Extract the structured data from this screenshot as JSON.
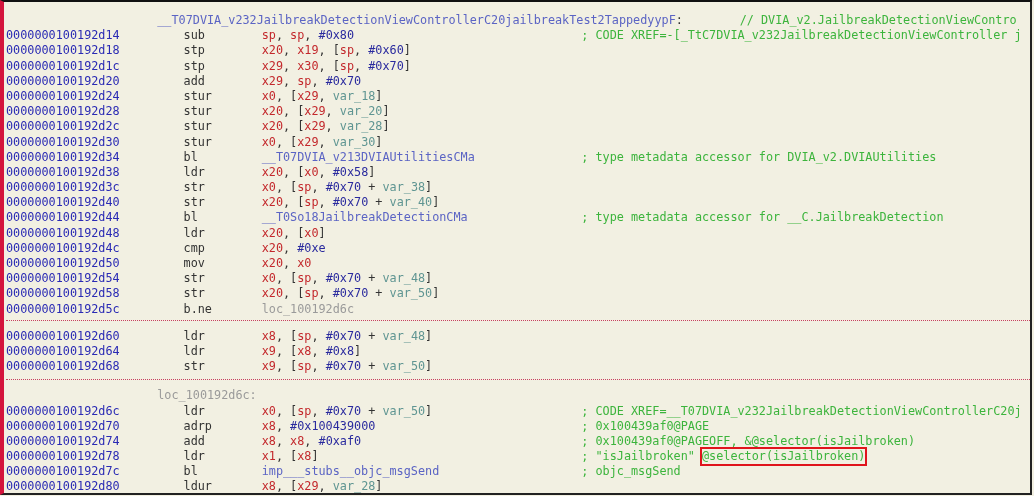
{
  "blocks": [
    {
      "label": [
        {
          "kind": "sym",
          "text": "__T07DVIA_v232JailbreakDetectionViewControllerC20jailbreakTest2TappedyypF"
        },
        {
          "kind": "pun",
          "text": ":"
        }
      ],
      "label_comment": "// DVIA_v2.JailbreakDetectionViewContro",
      "rows": [
        {
          "address": "0000000100192d14",
          "mnemonic": "sub",
          "operands": [
            {
              "kind": "reg",
              "text": "sp"
            },
            {
              "kind": "pun",
              "text": ", "
            },
            {
              "kind": "reg",
              "text": "sp"
            },
            {
              "kind": "pun",
              "text": ", "
            },
            {
              "kind": "imm",
              "text": "#0x80"
            }
          ],
          "comment": "; CODE XREF=-[_TtC7DVIA_v232JailbreakDetectionViewController j"
        },
        {
          "address": "0000000100192d18",
          "mnemonic": "stp",
          "operands": [
            {
              "kind": "reg",
              "text": "x20"
            },
            {
              "kind": "pun",
              "text": ", "
            },
            {
              "kind": "reg",
              "text": "x19"
            },
            {
              "kind": "pun",
              "text": ", ["
            },
            {
              "kind": "reg",
              "text": "sp"
            },
            {
              "kind": "pun",
              "text": ", "
            },
            {
              "kind": "imm",
              "text": "#0x60"
            },
            {
              "kind": "pun",
              "text": "]"
            }
          ]
        },
        {
          "address": "0000000100192d1c",
          "mnemonic": "stp",
          "operands": [
            {
              "kind": "reg",
              "text": "x29"
            },
            {
              "kind": "pun",
              "text": ", "
            },
            {
              "kind": "reg",
              "text": "x30"
            },
            {
              "kind": "pun",
              "text": ", ["
            },
            {
              "kind": "reg",
              "text": "sp"
            },
            {
              "kind": "pun",
              "text": ", "
            },
            {
              "kind": "imm",
              "text": "#0x70"
            },
            {
              "kind": "pun",
              "text": "]"
            }
          ]
        },
        {
          "address": "0000000100192d20",
          "mnemonic": "add",
          "operands": [
            {
              "kind": "reg",
              "text": "x29"
            },
            {
              "kind": "pun",
              "text": ", "
            },
            {
              "kind": "reg",
              "text": "sp"
            },
            {
              "kind": "pun",
              "text": ", "
            },
            {
              "kind": "imm",
              "text": "#0x70"
            }
          ]
        },
        {
          "address": "0000000100192d24",
          "mnemonic": "stur",
          "operands": [
            {
              "kind": "reg",
              "text": "x0"
            },
            {
              "kind": "pun",
              "text": ", ["
            },
            {
              "kind": "reg",
              "text": "x29"
            },
            {
              "kind": "pun",
              "text": ", "
            },
            {
              "kind": "var",
              "text": "var_18"
            },
            {
              "kind": "pun",
              "text": "]"
            }
          ]
        },
        {
          "address": "0000000100192d28",
          "mnemonic": "stur",
          "operands": [
            {
              "kind": "reg",
              "text": "x20"
            },
            {
              "kind": "pun",
              "text": ", ["
            },
            {
              "kind": "reg",
              "text": "x29"
            },
            {
              "kind": "pun",
              "text": ", "
            },
            {
              "kind": "var",
              "text": "var_20"
            },
            {
              "kind": "pun",
              "text": "]"
            }
          ]
        },
        {
          "address": "0000000100192d2c",
          "mnemonic": "stur",
          "operands": [
            {
              "kind": "reg",
              "text": "x20"
            },
            {
              "kind": "pun",
              "text": ", ["
            },
            {
              "kind": "reg",
              "text": "x29"
            },
            {
              "kind": "pun",
              "text": ", "
            },
            {
              "kind": "var",
              "text": "var_28"
            },
            {
              "kind": "pun",
              "text": "]"
            }
          ]
        },
        {
          "address": "0000000100192d30",
          "mnemonic": "stur",
          "operands": [
            {
              "kind": "reg",
              "text": "x0"
            },
            {
              "kind": "pun",
              "text": ", ["
            },
            {
              "kind": "reg",
              "text": "x29"
            },
            {
              "kind": "pun",
              "text": ", "
            },
            {
              "kind": "var",
              "text": "var_30"
            },
            {
              "kind": "pun",
              "text": "]"
            }
          ]
        },
        {
          "address": "0000000100192d34",
          "mnemonic": "bl",
          "operands": [
            {
              "kind": "sym",
              "text": "__T07DVIA_v213DVIAUtilitiesCMa"
            }
          ],
          "comment": "; type metadata accessor for DVIA_v2.DVIAUtilities"
        },
        {
          "address": "0000000100192d38",
          "mnemonic": "ldr",
          "operands": [
            {
              "kind": "reg",
              "text": "x20"
            },
            {
              "kind": "pun",
              "text": ", ["
            },
            {
              "kind": "reg",
              "text": "x0"
            },
            {
              "kind": "pun",
              "text": ", "
            },
            {
              "kind": "imm",
              "text": "#0x58"
            },
            {
              "kind": "pun",
              "text": "]"
            }
          ]
        },
        {
          "address": "0000000100192d3c",
          "mnemonic": "str",
          "operands": [
            {
              "kind": "reg",
              "text": "x0"
            },
            {
              "kind": "pun",
              "text": ", ["
            },
            {
              "kind": "reg",
              "text": "sp"
            },
            {
              "kind": "pun",
              "text": ", "
            },
            {
              "kind": "imm",
              "text": "#0x70"
            },
            {
              "kind": "pun",
              "text": " + "
            },
            {
              "kind": "var",
              "text": "var_38"
            },
            {
              "kind": "pun",
              "text": "]"
            }
          ]
        },
        {
          "address": "0000000100192d40",
          "mnemonic": "str",
          "operands": [
            {
              "kind": "reg",
              "text": "x20"
            },
            {
              "kind": "pun",
              "text": ", ["
            },
            {
              "kind": "reg",
              "text": "sp"
            },
            {
              "kind": "pun",
              "text": ", "
            },
            {
              "kind": "imm",
              "text": "#0x70"
            },
            {
              "kind": "pun",
              "text": " + "
            },
            {
              "kind": "var",
              "text": "var_40"
            },
            {
              "kind": "pun",
              "text": "]"
            }
          ]
        },
        {
          "address": "0000000100192d44",
          "mnemonic": "bl",
          "operands": [
            {
              "kind": "sym",
              "text": "__T0So18JailbreakDetectionCMa"
            }
          ],
          "comment": "; type metadata accessor for __C.JailbreakDetection"
        },
        {
          "address": "0000000100192d48",
          "mnemonic": "ldr",
          "operands": [
            {
              "kind": "reg",
              "text": "x20"
            },
            {
              "kind": "pun",
              "text": ", ["
            },
            {
              "kind": "reg",
              "text": "x0"
            },
            {
              "kind": "pun",
              "text": "]"
            }
          ]
        },
        {
          "address": "0000000100192d4c",
          "mnemonic": "cmp",
          "operands": [
            {
              "kind": "reg",
              "text": "x20"
            },
            {
              "kind": "pun",
              "text": ", "
            },
            {
              "kind": "imm",
              "text": "#0xe"
            }
          ]
        },
        {
          "address": "0000000100192d50",
          "mnemonic": "mov",
          "operands": [
            {
              "kind": "reg",
              "text": "x20"
            },
            {
              "kind": "pun",
              "text": ", "
            },
            {
              "kind": "reg",
              "text": "x0"
            }
          ]
        },
        {
          "address": "0000000100192d54",
          "mnemonic": "str",
          "operands": [
            {
              "kind": "reg",
              "text": "x0"
            },
            {
              "kind": "pun",
              "text": ", ["
            },
            {
              "kind": "reg",
              "text": "sp"
            },
            {
              "kind": "pun",
              "text": ", "
            },
            {
              "kind": "imm",
              "text": "#0x70"
            },
            {
              "kind": "pun",
              "text": " + "
            },
            {
              "kind": "var",
              "text": "var_48"
            },
            {
              "kind": "pun",
              "text": "]"
            }
          ]
        },
        {
          "address": "0000000100192d58",
          "mnemonic": "str",
          "operands": [
            {
              "kind": "reg",
              "text": "x20"
            },
            {
              "kind": "pun",
              "text": ", ["
            },
            {
              "kind": "reg",
              "text": "sp"
            },
            {
              "kind": "pun",
              "text": ", "
            },
            {
              "kind": "imm",
              "text": "#0x70"
            },
            {
              "kind": "pun",
              "text": " + "
            },
            {
              "kind": "var",
              "text": "var_50"
            },
            {
              "kind": "pun",
              "text": "]"
            }
          ]
        },
        {
          "address": "0000000100192d5c",
          "mnemonic": "b.ne",
          "operands": [
            {
              "kind": "loc",
              "text": "loc_100192d6c"
            }
          ]
        }
      ]
    },
    {
      "rows": [
        {
          "address": "0000000100192d60",
          "mnemonic": "ldr",
          "operands": [
            {
              "kind": "reg",
              "text": "x8"
            },
            {
              "kind": "pun",
              "text": ", ["
            },
            {
              "kind": "reg",
              "text": "sp"
            },
            {
              "kind": "pun",
              "text": ", "
            },
            {
              "kind": "imm",
              "text": "#0x70"
            },
            {
              "kind": "pun",
              "text": " + "
            },
            {
              "kind": "var",
              "text": "var_48"
            },
            {
              "kind": "pun",
              "text": "]"
            }
          ]
        },
        {
          "address": "0000000100192d64",
          "mnemonic": "ldr",
          "operands": [
            {
              "kind": "reg",
              "text": "x9"
            },
            {
              "kind": "pun",
              "text": ", ["
            },
            {
              "kind": "reg",
              "text": "x8"
            },
            {
              "kind": "pun",
              "text": ", "
            },
            {
              "kind": "imm",
              "text": "#0x8"
            },
            {
              "kind": "pun",
              "text": "]"
            }
          ]
        },
        {
          "address": "0000000100192d68",
          "mnemonic": "str",
          "operands": [
            {
              "kind": "reg",
              "text": "x9"
            },
            {
              "kind": "pun",
              "text": ", ["
            },
            {
              "kind": "reg",
              "text": "sp"
            },
            {
              "kind": "pun",
              "text": ", "
            },
            {
              "kind": "imm",
              "text": "#0x70"
            },
            {
              "kind": "pun",
              "text": " + "
            },
            {
              "kind": "var",
              "text": "var_50"
            },
            {
              "kind": "pun",
              "text": "]"
            }
          ]
        }
      ]
    },
    {
      "label": [
        {
          "kind": "loc",
          "text": "loc_100192d6c:"
        }
      ],
      "rows": [
        {
          "address": "0000000100192d6c",
          "mnemonic": "ldr",
          "operands": [
            {
              "kind": "reg",
              "text": "x0"
            },
            {
              "kind": "pun",
              "text": ", ["
            },
            {
              "kind": "reg",
              "text": "sp"
            },
            {
              "kind": "pun",
              "text": ", "
            },
            {
              "kind": "imm",
              "text": "#0x70"
            },
            {
              "kind": "pun",
              "text": " + "
            },
            {
              "kind": "var",
              "text": "var_50"
            },
            {
              "kind": "pun",
              "text": "]"
            }
          ],
          "comment": "; CODE XREF=__T07DVIA_v232JailbreakDetectionViewControllerC20j"
        },
        {
          "address": "0000000100192d70",
          "mnemonic": "adrp",
          "operands": [
            {
              "kind": "reg",
              "text": "x8"
            },
            {
              "kind": "pun",
              "text": ", "
            },
            {
              "kind": "imm",
              "text": "#0x100439000"
            }
          ],
          "comment": "; 0x100439af0@PAGE"
        },
        {
          "address": "0000000100192d74",
          "mnemonic": "add",
          "operands": [
            {
              "kind": "reg",
              "text": "x8"
            },
            {
              "kind": "pun",
              "text": ", "
            },
            {
              "kind": "reg",
              "text": "x8"
            },
            {
              "kind": "pun",
              "text": ", "
            },
            {
              "kind": "imm",
              "text": "#0xaf0"
            }
          ],
          "comment": "; 0x100439af0@PAGEOFF, &@selector(isJailbroken)"
        },
        {
          "address": "0000000100192d78",
          "mnemonic": "ldr",
          "operands": [
            {
              "kind": "reg",
              "text": "x1"
            },
            {
              "kind": "pun",
              "text": ", ["
            },
            {
              "kind": "reg",
              "text": "x8"
            },
            {
              "kind": "pun",
              "text": "]"
            }
          ],
          "comment": "; \"isJailbroken\"",
          "highlight": "@selector(isJailbroken)"
        },
        {
          "address": "0000000100192d7c",
          "mnemonic": "bl",
          "operands": [
            {
              "kind": "sym",
              "text": "imp___stubs__objc_msgSend"
            }
          ],
          "comment": "; objc_msgSend"
        },
        {
          "address": "0000000100192d80",
          "mnemonic": "ldur",
          "operands": [
            {
              "kind": "reg",
              "text": "x8"
            },
            {
              "kind": "pun",
              "text": ", ["
            },
            {
              "kind": "reg",
              "text": "x29"
            },
            {
              "kind": "pun",
              "text": ", "
            },
            {
              "kind": "var",
              "text": "var_28"
            },
            {
              "kind": "pun",
              "text": "]"
            }
          ]
        }
      ]
    }
  ]
}
